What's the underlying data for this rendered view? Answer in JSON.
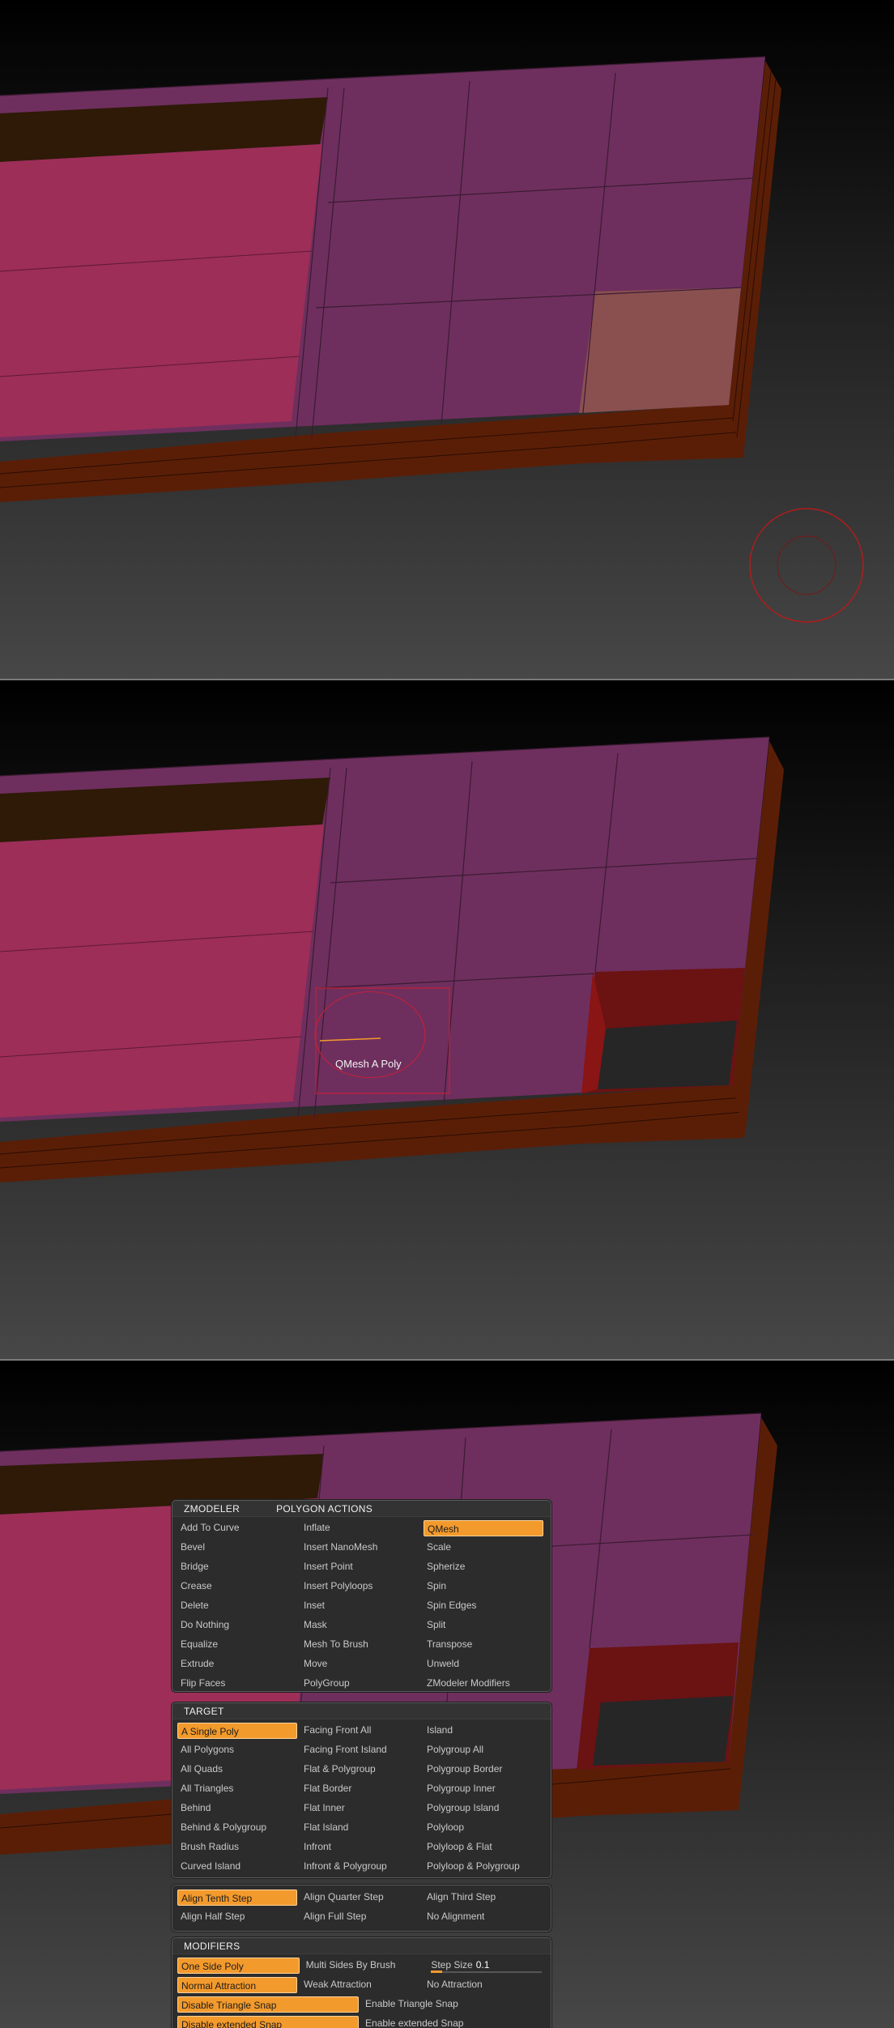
{
  "tooltip": "QMesh A Poly",
  "menu": {
    "header_left": "ZMODELER",
    "header_right": "POLYGON ACTIONS",
    "actions": [
      "Add To Curve",
      "Inflate",
      "QMesh",
      "Bevel",
      "Insert NanoMesh",
      "Scale",
      "Bridge",
      "Insert Point",
      "Spherize",
      "Crease",
      "Insert Polyloops",
      "Spin",
      "Delete",
      "Inset",
      "Spin Edges",
      "Do Nothing",
      "Mask",
      "Split",
      "Equalize",
      "Mesh To Brush",
      "Transpose",
      "Extrude",
      "Move",
      "Unweld",
      "Flip Faces",
      "PolyGroup",
      "ZModeler Modifiers"
    ],
    "actions_selected": "QMesh"
  },
  "target": {
    "header": "TARGET",
    "items": [
      "A Single Poly",
      "Facing Front All",
      "Island",
      "All Polygons",
      "Facing Front Island",
      "Polygroup All",
      "All Quads",
      "Flat & Polygroup",
      "Polygroup Border",
      "All Triangles",
      "Flat Border",
      "Polygroup Inner",
      "Behind",
      "Flat Inner",
      "Polygroup Island",
      "Behind & Polygroup",
      "Flat Island",
      "Polyloop",
      "Brush Radius",
      "Infront",
      "Polyloop & Flat",
      "Curved Island",
      "Infront & Polygroup",
      "Polyloop & Polygroup"
    ],
    "selected": "A Single Poly"
  },
  "align": {
    "items": [
      "Align Tenth Step",
      "Align Quarter Step",
      "Align Third Step",
      "Align Half Step",
      "Align Full Step",
      "No Alignment"
    ],
    "selected": "Align Tenth Step"
  },
  "modifiers": {
    "header": "MODIFIERS",
    "one_side_poly": "One Side Poly",
    "multi_sides": "Multi Sides By Brush",
    "step_size_label": "Step Size",
    "step_size_value": "0.1",
    "step_size_fraction": 0.1,
    "normal_attraction": "Normal Attraction",
    "weak_attraction": "Weak Attraction",
    "no_attraction": "No Attraction",
    "disable_triangle_snap": "Disable Triangle Snap",
    "enable_triangle_snap": "Enable Triangle Snap",
    "disable_extended_snap": "Disable extended Snap",
    "enable_extended_snap": "Enable extended Snap"
  },
  "colors": {
    "accent": "#f39a2c",
    "mesh_purple": "#6e2f5e",
    "mesh_pink": "#9d2e58",
    "mesh_brown": "#5a1e07",
    "hole_red": "#6b1212",
    "highlight_poly": "#8a5050"
  }
}
